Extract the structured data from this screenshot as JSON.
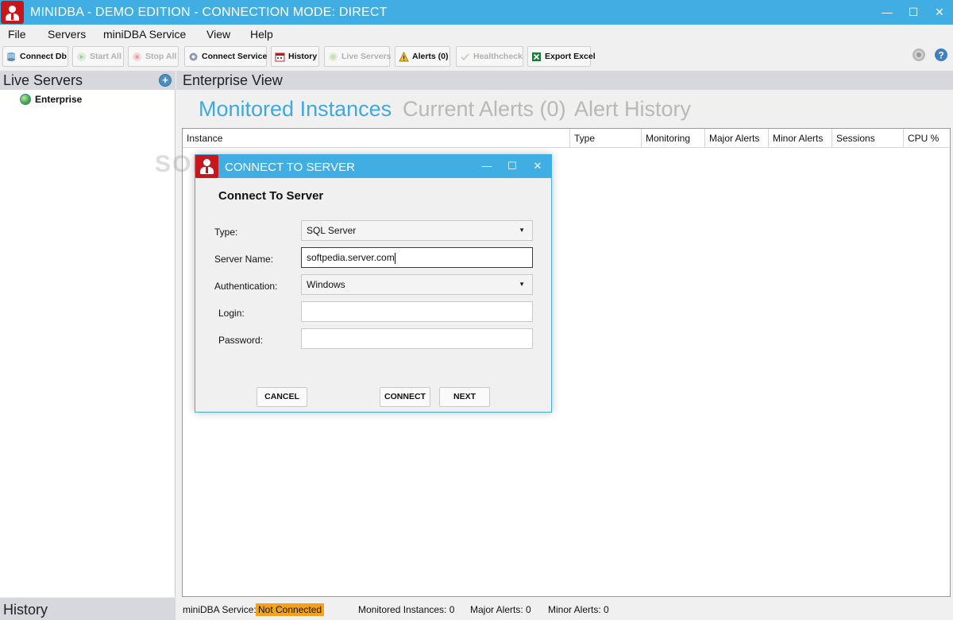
{
  "window": {
    "title": "MINIDBA - DEMO EDITION - CONNECTION MODE: DIRECT",
    "minimize": "—",
    "maximize": "☐",
    "close": "✕"
  },
  "menu": [
    "File",
    "Servers",
    "miniDBA Service",
    "View",
    "Help"
  ],
  "toolbar": {
    "connect_db": "Connect Db",
    "start_all": "Start All",
    "stop_all": "Stop All",
    "connect_service": "Connect Service",
    "history": "History",
    "live_servers": "Live Servers",
    "alerts": "Alerts (0)",
    "healthcheck": "Healthcheck",
    "export_excel": "Export Excel"
  },
  "left_panel": {
    "title": "Live Servers",
    "add": "+",
    "tree": [
      {
        "label": "Enterprise"
      }
    ],
    "history_title": "History"
  },
  "main": {
    "title": "Enterprise View",
    "tabs": [
      {
        "label": "Monitored Instances",
        "active": true
      },
      {
        "label": "Current Alerts (0)",
        "active": false
      },
      {
        "label": "Alert History",
        "active": false
      }
    ],
    "columns": [
      "Instance",
      "Type",
      "Monitoring",
      "Major Alerts",
      "Minor Alerts",
      "Sessions",
      "CPU %"
    ]
  },
  "watermark": "SOFTPEDIA",
  "dialog": {
    "title": "CONNECT TO SERVER",
    "minimize": "—",
    "maximize": "☐",
    "close": "✕",
    "heading": "Connect To Server",
    "type_label": "Type:",
    "type_value": "SQL Server",
    "server_label": "Server Name:",
    "server_value": "softpedia.server.com",
    "auth_label": "Authentication:",
    "auth_value": "Windows",
    "login_label": "Login:",
    "login_value": "",
    "password_label": "Password:",
    "password_value": "",
    "cancel": "CANCEL",
    "connect": "CONNECT",
    "next": "NEXT"
  },
  "status": {
    "service_label": "miniDBA Service:",
    "service_state": "Not Connected",
    "monitored": "Monitored Instances: 0",
    "major": "Major Alerts: 0",
    "minor": "Minor Alerts: 0"
  },
  "colors": {
    "accent": "#41aee3",
    "brand_red": "#c8161d",
    "tab_active": "#3fa9dc",
    "tab_inactive": "#b8b8b8",
    "warning": "#f5a21b"
  }
}
